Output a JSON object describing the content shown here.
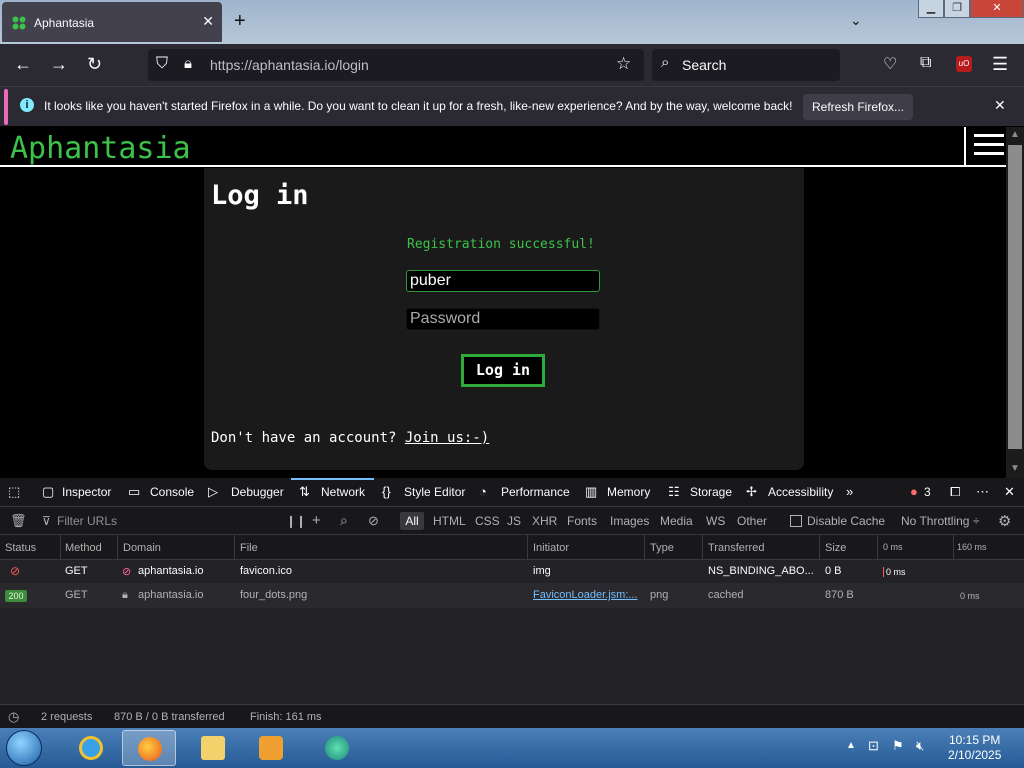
{
  "browser": {
    "tab_title": "Aphantasia",
    "new_tab": "+",
    "url_host": "https://aphantasia.io",
    "url_path": "/login",
    "search_placeholder": "Search",
    "notification": {
      "message": "It looks like you haven't started Firefox in a while. Do you want to clean it up for a fresh, like-new experience? And by the way, welcome back!",
      "button": "Refresh Firefox..."
    }
  },
  "site": {
    "logo": "Aphantasia",
    "heading": "Log in",
    "success_message": "Registration successful!",
    "username_value": "puber",
    "password_placeholder": "Password",
    "login_button": "Log in",
    "join_prompt": "Don't have an account?",
    "join_link": "Join us:-)"
  },
  "devtools": {
    "tabs": [
      "Inspector",
      "Console",
      "Debugger",
      "Network",
      "Style Editor",
      "Performance",
      "Memory",
      "Storage",
      "Accessibility"
    ],
    "active_tab": "Network",
    "error_count": "3",
    "filter_placeholder": "Filter URLs",
    "filters": [
      "All",
      "HTML",
      "CSS",
      "JS",
      "XHR",
      "Fonts",
      "Images",
      "Media",
      "WS",
      "Other"
    ],
    "disable_cache": "Disable Cache",
    "throttling": "No Throttling ÷",
    "columns": [
      "Status",
      "Method",
      "Domain",
      "File",
      "Initiator",
      "Type",
      "Transferred",
      "Size",
      "0 ms",
      "160 ms"
    ],
    "rows": [
      {
        "status": "",
        "method": "GET",
        "domain": "aphantasia.io",
        "file": "favicon.ico",
        "initiator": "img",
        "type": "",
        "transferred": "NS_BINDING_ABO...",
        "size": "0 B",
        "waterfall": "0 ms"
      },
      {
        "status": "200",
        "method": "GET",
        "domain": "aphantasia.io",
        "file": "four_dots.png",
        "initiator": "FaviconLoader.jsm:...",
        "type": "png",
        "transferred": "cached",
        "size": "870 B",
        "waterfall": "0 ms"
      }
    ],
    "summary": {
      "requests": "2 requests",
      "transferred": "870 B / 0 B transferred",
      "finish": "Finish: 161 ms"
    }
  },
  "taskbar": {
    "time": "10:15 PM",
    "date": "2/10/2025"
  },
  "colors": {
    "accent_green": "#3cc24a",
    "devtools_bg": "#232327",
    "browser_chrome": "#2b2a33"
  }
}
